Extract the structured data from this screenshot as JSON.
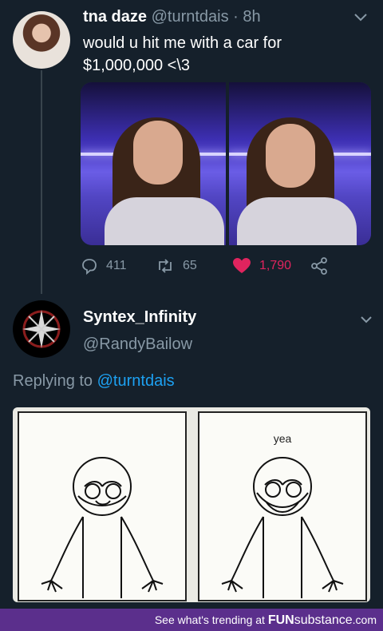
{
  "tweet": {
    "display_name": "tna daze",
    "handle": "@turntdais",
    "separator": "·",
    "time": "8h",
    "text": "would u hit me with a car for $1,000,000 <\\3",
    "stats": {
      "replies": "411",
      "retweets": "65",
      "likes": "1,790"
    },
    "like_color": "#e0245e"
  },
  "reply_tweet": {
    "display_name": "Syntex_Infinity",
    "handle": "@RandyBailow",
    "replying_prefix": "Replying to",
    "replying_mention": "@turntdais",
    "comic_caption": "yea"
  },
  "footer": {
    "prefix": "See what's trending at",
    "brand_bold": "FUN",
    "brand_rest": "substance",
    "suffix": ".com",
    "color": "#5b2f8c"
  },
  "icons": [
    "reply-icon",
    "retweet-icon",
    "heart-icon",
    "share-icon",
    "chevron-down-icon"
  ]
}
